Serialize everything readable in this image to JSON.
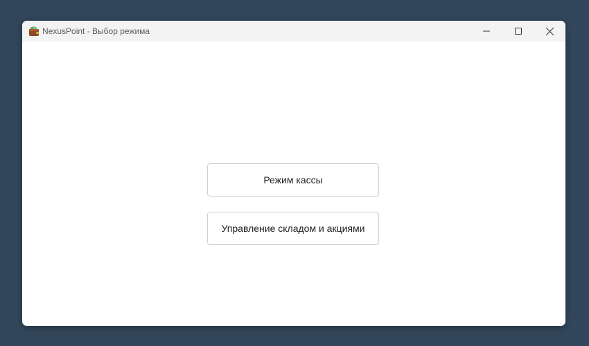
{
  "window": {
    "title": "NexusPoint - Выбор режима",
    "icon": "wallet-icon",
    "controls": {
      "minimize": "minimize-icon",
      "maximize": "maximize-icon",
      "close": "close-icon"
    }
  },
  "modes": [
    {
      "label": "Режим кассы"
    },
    {
      "label": "Управление складом и акциями"
    }
  ],
  "colors": {
    "desktop": "#33475c",
    "titlebar": "#f3f3f3",
    "content": "#ffffff",
    "button_border": "#cfcfcf"
  }
}
